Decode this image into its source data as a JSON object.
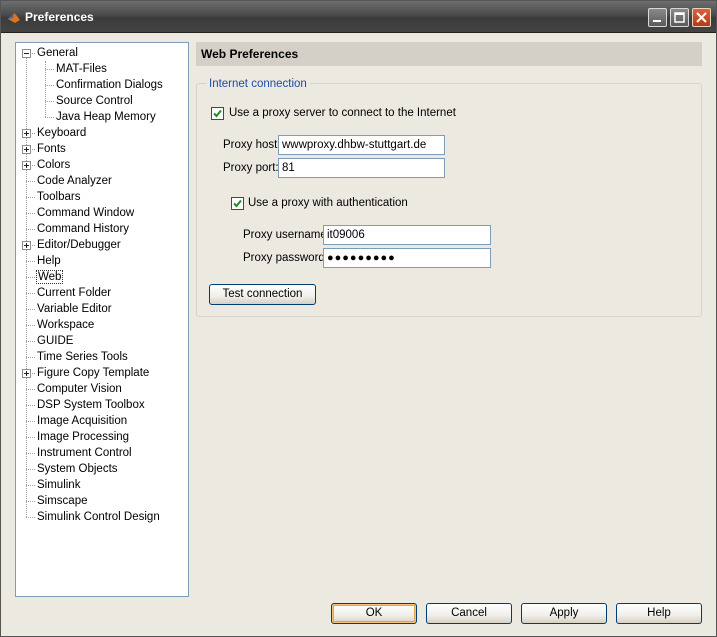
{
  "window": {
    "title": "Preferences"
  },
  "tree": {
    "items": [
      {
        "label": "General",
        "level": 0,
        "expander": "minus"
      },
      {
        "label": "MAT-Files",
        "level": 1
      },
      {
        "label": "Confirmation Dialogs",
        "level": 1
      },
      {
        "label": "Source Control",
        "level": 1
      },
      {
        "label": "Java Heap Memory",
        "level": 1
      },
      {
        "label": "Keyboard",
        "level": 0,
        "expander": "plus"
      },
      {
        "label": "Fonts",
        "level": 0,
        "expander": "plus"
      },
      {
        "label": "Colors",
        "level": 0,
        "expander": "plus"
      },
      {
        "label": "Code Analyzer",
        "level": 0
      },
      {
        "label": "Toolbars",
        "level": 0
      },
      {
        "label": "Command Window",
        "level": 0
      },
      {
        "label": "Command History",
        "level": 0
      },
      {
        "label": "Editor/Debugger",
        "level": 0,
        "expander": "plus"
      },
      {
        "label": "Help",
        "level": 0
      },
      {
        "label": "Web",
        "level": 0,
        "selected": true
      },
      {
        "label": "Current Folder",
        "level": 0
      },
      {
        "label": "Variable Editor",
        "level": 0
      },
      {
        "label": "Workspace",
        "level": 0
      },
      {
        "label": "GUIDE",
        "level": 0
      },
      {
        "label": "Time Series Tools",
        "level": 0
      },
      {
        "label": "Figure Copy Template",
        "level": 0,
        "expander": "plus"
      },
      {
        "label": "Computer Vision",
        "level": 0
      },
      {
        "label": "DSP System Toolbox",
        "level": 0
      },
      {
        "label": "Image Acquisition",
        "level": 0
      },
      {
        "label": "Image Processing",
        "level": 0
      },
      {
        "label": "Instrument Control",
        "level": 0
      },
      {
        "label": "System Objects",
        "level": 0
      },
      {
        "label": "Simulink",
        "level": 0
      },
      {
        "label": "Simscape",
        "level": 0
      },
      {
        "label": "Simulink Control Design",
        "level": 0
      }
    ]
  },
  "panel": {
    "title": "Web Preferences",
    "group_title": "Internet connection",
    "use_proxy": {
      "label": "Use a proxy server to connect to the Internet",
      "checked": true
    },
    "proxy_host": {
      "label": "Proxy host:",
      "value": "wwwproxy.dhbw-stuttgart.de"
    },
    "proxy_port": {
      "label": "Proxy port:",
      "value": "81"
    },
    "use_auth": {
      "label": "Use a proxy with authentication",
      "checked": true
    },
    "proxy_username": {
      "label": "Proxy username:",
      "value": "it09006"
    },
    "proxy_password": {
      "label": "Proxy password:",
      "value": "●●●●●●●●●"
    },
    "test_button": "Test connection"
  },
  "footer": {
    "ok": "OK",
    "cancel": "Cancel",
    "apply": "Apply",
    "help": "Help"
  },
  "colors": {
    "accent_legend": "#1b4da8",
    "titlebar": "#4a4a4a",
    "close_button": "#c44a26"
  }
}
